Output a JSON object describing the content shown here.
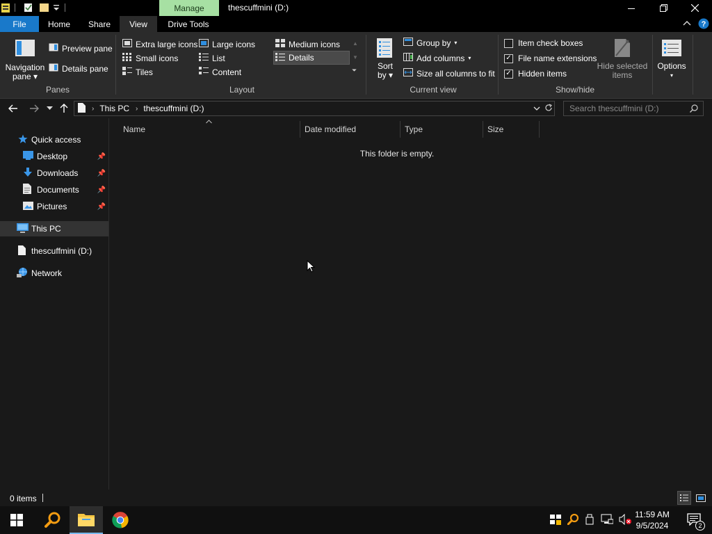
{
  "titlebar": {
    "context_tab": "Manage",
    "title": "thescuffmini (D:)"
  },
  "ribbon_tabs": {
    "file": "File",
    "home": "Home",
    "share": "Share",
    "view": "View",
    "drive_tools": "Drive Tools"
  },
  "panes": {
    "label": "Panes",
    "navigation_pane_line1": "Navigation",
    "navigation_pane_line2": "pane",
    "preview_pane": "Preview pane",
    "details_pane": "Details pane"
  },
  "layout": {
    "label": "Layout",
    "extra_large_icons": "Extra large icons",
    "large_icons": "Large icons",
    "medium_icons": "Medium icons",
    "small_icons": "Small icons",
    "list": "List",
    "details": "Details",
    "tiles": "Tiles",
    "content": "Content",
    "selected": "Details"
  },
  "current_view": {
    "label": "Current view",
    "sort_by_line1": "Sort",
    "sort_by_line2": "by",
    "group_by": "Group by",
    "add_columns": "Add columns",
    "size_all_columns": "Size all columns to fit"
  },
  "show_hide": {
    "label": "Show/hide",
    "item_check_boxes": "Item check boxes",
    "item_check_boxes_checked": false,
    "file_name_extensions": "File name extensions",
    "file_name_extensions_checked": true,
    "hidden_items": "Hidden items",
    "hidden_items_checked": true,
    "hide_selected_line1": "Hide selected",
    "hide_selected_line2": "items"
  },
  "options": {
    "label": "Options"
  },
  "address": {
    "crumb1": "This PC",
    "crumb2": "thescuffmini (D:)",
    "search_placeholder": "Search thescuffmini (D:)"
  },
  "nav_pane": {
    "quick_access": "Quick access",
    "desktop": "Desktop",
    "downloads": "Downloads",
    "documents": "Documents",
    "pictures": "Pictures",
    "this_pc": "This PC",
    "drive": "thescuffmini (D:)",
    "network": "Network"
  },
  "columns": {
    "name": "Name",
    "date_modified": "Date modified",
    "type": "Type",
    "size": "Size"
  },
  "content": {
    "empty_message": "This folder is empty."
  },
  "status": {
    "item_count": "0 items"
  },
  "taskbar": {
    "time": "11:59 AM",
    "date": "9/5/2024",
    "notification_count": "2"
  },
  "colors": {
    "file_tab": "#1979ca",
    "manage_tab": "#a7e0a3",
    "background": "#191919",
    "ribbon": "#2b2b2b"
  }
}
